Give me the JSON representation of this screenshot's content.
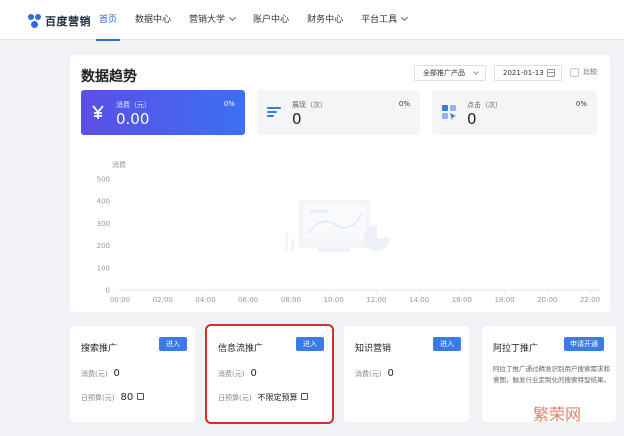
{
  "brand": {
    "name": "百度营销",
    "accent": "#2d6cdf"
  },
  "nav": {
    "items": [
      {
        "label": "首页",
        "active": true,
        "dropdown": false
      },
      {
        "label": "数据中心",
        "active": false,
        "dropdown": false
      },
      {
        "label": "营销大学",
        "active": false,
        "dropdown": true
      },
      {
        "label": "账户中心",
        "active": false,
        "dropdown": false
      },
      {
        "label": "财务中心",
        "active": false,
        "dropdown": false
      },
      {
        "label": "平台工具",
        "active": false,
        "dropdown": true
      }
    ]
  },
  "trend": {
    "title": "数据趋势",
    "product_select": "全部推广产品",
    "date": "2021-01-13",
    "compare_label": "比较",
    "metrics": [
      {
        "label": "消费（元）",
        "value": "0.00",
        "pct": "0%",
        "icon": "yen-icon"
      },
      {
        "label": "展现（次）",
        "value": "0",
        "pct": "0%",
        "icon": "list-icon"
      },
      {
        "label": "点击（次）",
        "value": "0",
        "pct": "0%",
        "icon": "click-icon"
      }
    ]
  },
  "chart_data": {
    "type": "line",
    "title": "",
    "ylabel": "消费",
    "xlabel": "",
    "categories": [
      "00:00",
      "02:00",
      "04:00",
      "06:00",
      "08:00",
      "10:00",
      "12:00",
      "14:00",
      "16:00",
      "18:00",
      "20:00",
      "22:00"
    ],
    "yticks": [
      "0",
      "100",
      "200",
      "300",
      "400",
      "500"
    ],
    "ylim": [
      0,
      500
    ],
    "grid": false,
    "series": [],
    "empty_state_icon": "empty-data-illustration"
  },
  "cards": [
    {
      "title": "搜索推广",
      "button": "进入",
      "rows": [
        {
          "label": "消费(元)",
          "value": "0"
        },
        {
          "label": "日预算(元)",
          "value": "80"
        }
      ]
    },
    {
      "title": "信息流推广",
      "button": "进入",
      "highlighted": true,
      "rows": [
        {
          "label": "消费(元)",
          "value": "0"
        },
        {
          "label": "日预算(元)",
          "value": "不限定预算"
        }
      ]
    },
    {
      "title": "知识营销",
      "button": "进入",
      "rows": [
        {
          "label": "消费(元)",
          "value": "0"
        }
      ]
    },
    {
      "title": "阿拉丁推广",
      "button": "申请开通",
      "description": "阿拉丁推广通过精准识别用户搜索需求和意图，触发行业定制化的搜索特型结果。"
    }
  ],
  "watermark": "繁荣网"
}
